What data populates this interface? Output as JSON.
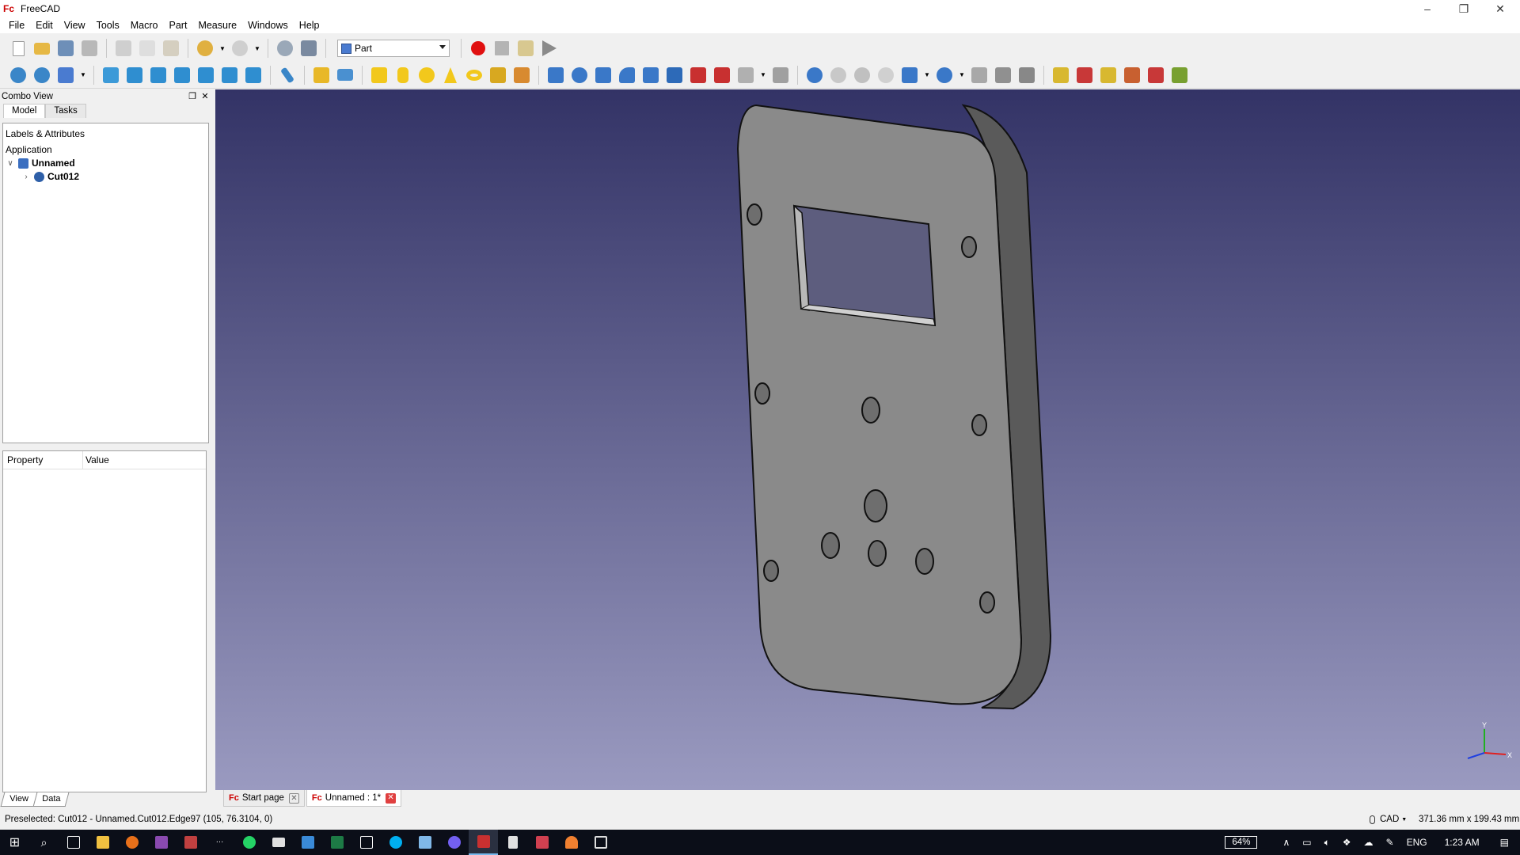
{
  "window": {
    "title": "FreeCAD",
    "icon": "freecad-logo-icon"
  },
  "menubar": {
    "items": [
      "File",
      "Edit",
      "View",
      "Tools",
      "Macro",
      "Part",
      "Measure",
      "Windows",
      "Help"
    ]
  },
  "toolbar": {
    "workbench": "Part"
  },
  "combo_view": {
    "title": "Combo View",
    "tabs": [
      "Model",
      "Tasks"
    ],
    "tree": {
      "header": "Labels & Attributes",
      "application": "Application",
      "document": "Unnamed",
      "object": "Cut012"
    },
    "property_table": {
      "col_property": "Property",
      "col_value": "Value"
    },
    "property_tabs": [
      "View",
      "Data"
    ]
  },
  "document_tabs": [
    {
      "label": "Start page"
    },
    {
      "label": "Unnamed : 1*"
    }
  ],
  "axis": {
    "x": "X",
    "y": "Y"
  },
  "statusbar": {
    "message": "Preselected: Cut012 - Unnamed.Cut012.Edge97 (105, 76.3104, 0)",
    "nav_style": "CAD",
    "dimensions": "371.36 mm x 199.43 mm"
  },
  "taskbar": {
    "battery": "64%",
    "language": "ENG",
    "time": "1:23 AM"
  },
  "colors": {
    "viewport_top": "#333366",
    "viewport_bottom": "#9a9ac0",
    "record_red": "#e01010"
  }
}
